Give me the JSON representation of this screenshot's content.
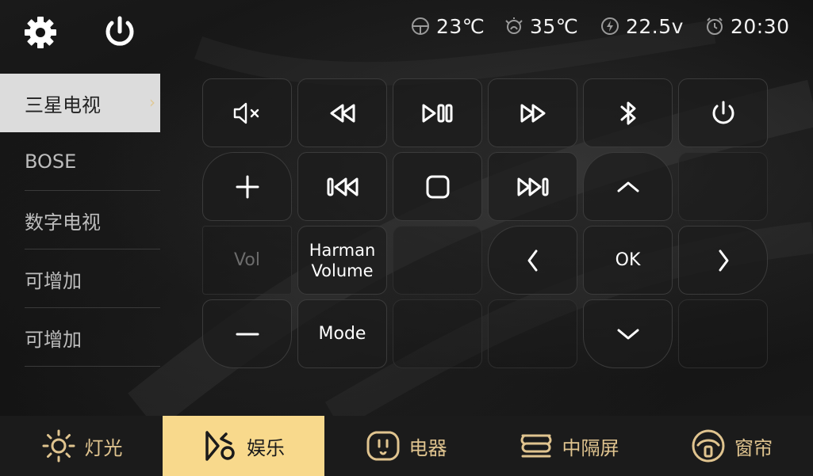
{
  "status": {
    "indoor_temp": "23℃",
    "outdoor_temp": "35℃",
    "voltage": "22.5v",
    "time": "20:30"
  },
  "sidebar": {
    "items": [
      {
        "label": "三星电视",
        "active": true
      },
      {
        "label": "BOSE",
        "active": false
      },
      {
        "label": "数字电视",
        "active": false
      },
      {
        "label": "可增加",
        "active": false
      },
      {
        "label": "可增加",
        "active": false
      }
    ]
  },
  "remote": {
    "vol_label": "Vol",
    "harman_line1": "Harman",
    "harman_line2": "Volume",
    "ok_label": "OK",
    "mode_label": "Mode"
  },
  "bottom_nav": {
    "tabs": [
      {
        "label": "灯光",
        "icon": "light-icon",
        "active": false
      },
      {
        "label": "娱乐",
        "icon": "entertainment-icon",
        "active": true
      },
      {
        "label": "电器",
        "icon": "appliance-icon",
        "active": false
      },
      {
        "label": "中隔屏",
        "icon": "partition-screen-icon",
        "active": false
      },
      {
        "label": "窗帘",
        "icon": "curtain-icon",
        "active": false
      }
    ]
  },
  "colors": {
    "accent_gold": "#e0c48f",
    "active_tab_bg": "#f8d98c",
    "active_side_bg": "#dcdcdc"
  }
}
